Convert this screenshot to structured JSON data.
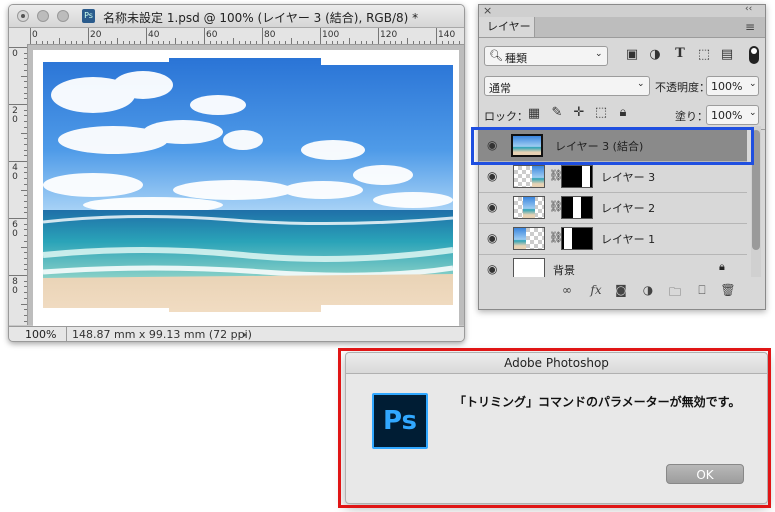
{
  "document_window": {
    "title": "名称未設定 1.psd @ 100% (レイヤー 3 (結合), RGB/8) *",
    "file_icon": "Ps",
    "ruler_horizontal": [
      "0",
      "20",
      "40",
      "60",
      "80",
      "100",
      "120",
      "140"
    ],
    "ruler_vertical": [
      "0",
      "2\n0",
      "4\n0",
      "6\n0",
      "8\n0"
    ],
    "status": {
      "zoom": "100%",
      "doc_size": "148.87 mm x 99.13 mm (72 ppi)",
      "arrow": "›"
    }
  },
  "layers_panel": {
    "collapse_glyph": "‹‹",
    "close_glyph": "×",
    "tab_label": "レイヤー",
    "menu_glyph": "≡",
    "filter": {
      "kind_label": "種類",
      "icons": [
        "image-filter-icon",
        "adjustment-filter-icon",
        "type-filter-icon",
        "shape-filter-icon",
        "smart-object-filter-icon"
      ]
    },
    "blend_mode": "通常",
    "opacity_label": "不透明度：",
    "opacity_value": "100%",
    "lock_label": "ロック：",
    "fill_label": "塗り：",
    "fill_value": "100%",
    "layers": [
      {
        "name": "レイヤー 3 (結合)",
        "selected": true,
        "thumb": "beach",
        "mask": false,
        "mask_pos": null
      },
      {
        "name": "レイヤー 3",
        "selected": false,
        "thumb": "checker-beach",
        "mask": true,
        "mask_pos": "right"
      },
      {
        "name": "レイヤー 2",
        "selected": false,
        "thumb": "checker-beach",
        "mask": true,
        "mask_pos": "middle"
      },
      {
        "name": "レイヤー 1",
        "selected": false,
        "thumb": "checker-beach",
        "mask": true,
        "mask_pos": "left"
      },
      {
        "name": "背景",
        "selected": false,
        "thumb": "white",
        "mask": false,
        "mask_pos": null,
        "locked": true
      }
    ],
    "footer_icons": [
      "link-layers-icon",
      "fx-icon",
      "add-mask-icon",
      "adjustment-layer-icon",
      "new-group-icon",
      "new-layer-icon",
      "delete-layer-icon"
    ],
    "footer_fx_label": "fx"
  },
  "dialog": {
    "title": "Adobe Photoshop",
    "logo": "Ps",
    "message": "「トリミング」コマンドのパラメーターが無効です。",
    "ok_label": "OK"
  },
  "colors": {
    "highlight_blue": "#1f4fe0",
    "highlight_red": "#e01515",
    "ps_blue": "#31a8ff",
    "ps_dark": "#001d34"
  }
}
